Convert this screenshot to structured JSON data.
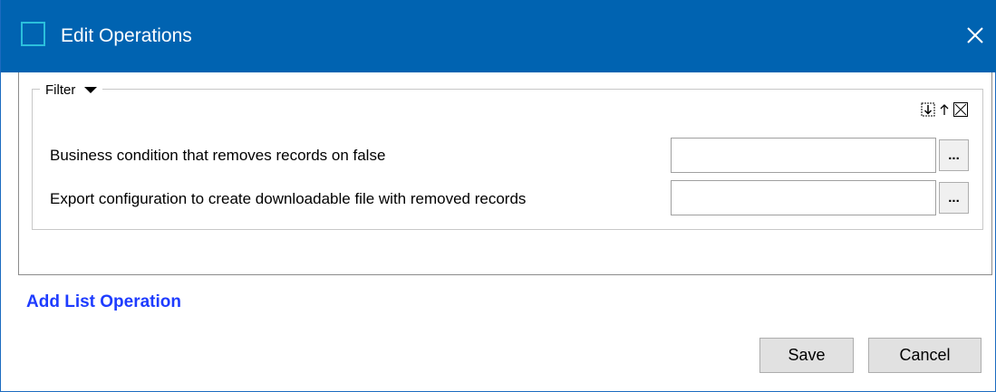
{
  "window": {
    "title": "Edit Operations",
    "accent_color": "#0063b1",
    "icon": "app-window-icon",
    "close_icon": "close-icon"
  },
  "filter": {
    "label": "Filter",
    "dropdown_icon": "triangle-down-icon",
    "tools": {
      "move_down_icon": "move-down-icon",
      "move_up_icon": "arrow-up-icon",
      "remove_icon": "close-box-icon"
    },
    "rows": [
      {
        "label": "Business condition that removes records on false",
        "value": "",
        "browse_label": "..."
      },
      {
        "label": "Export configuration to create downloadable file with removed records",
        "value": "",
        "browse_label": "..."
      }
    ]
  },
  "add_list_operation": "Add List Operation",
  "buttons": {
    "save": "Save",
    "cancel": "Cancel"
  }
}
